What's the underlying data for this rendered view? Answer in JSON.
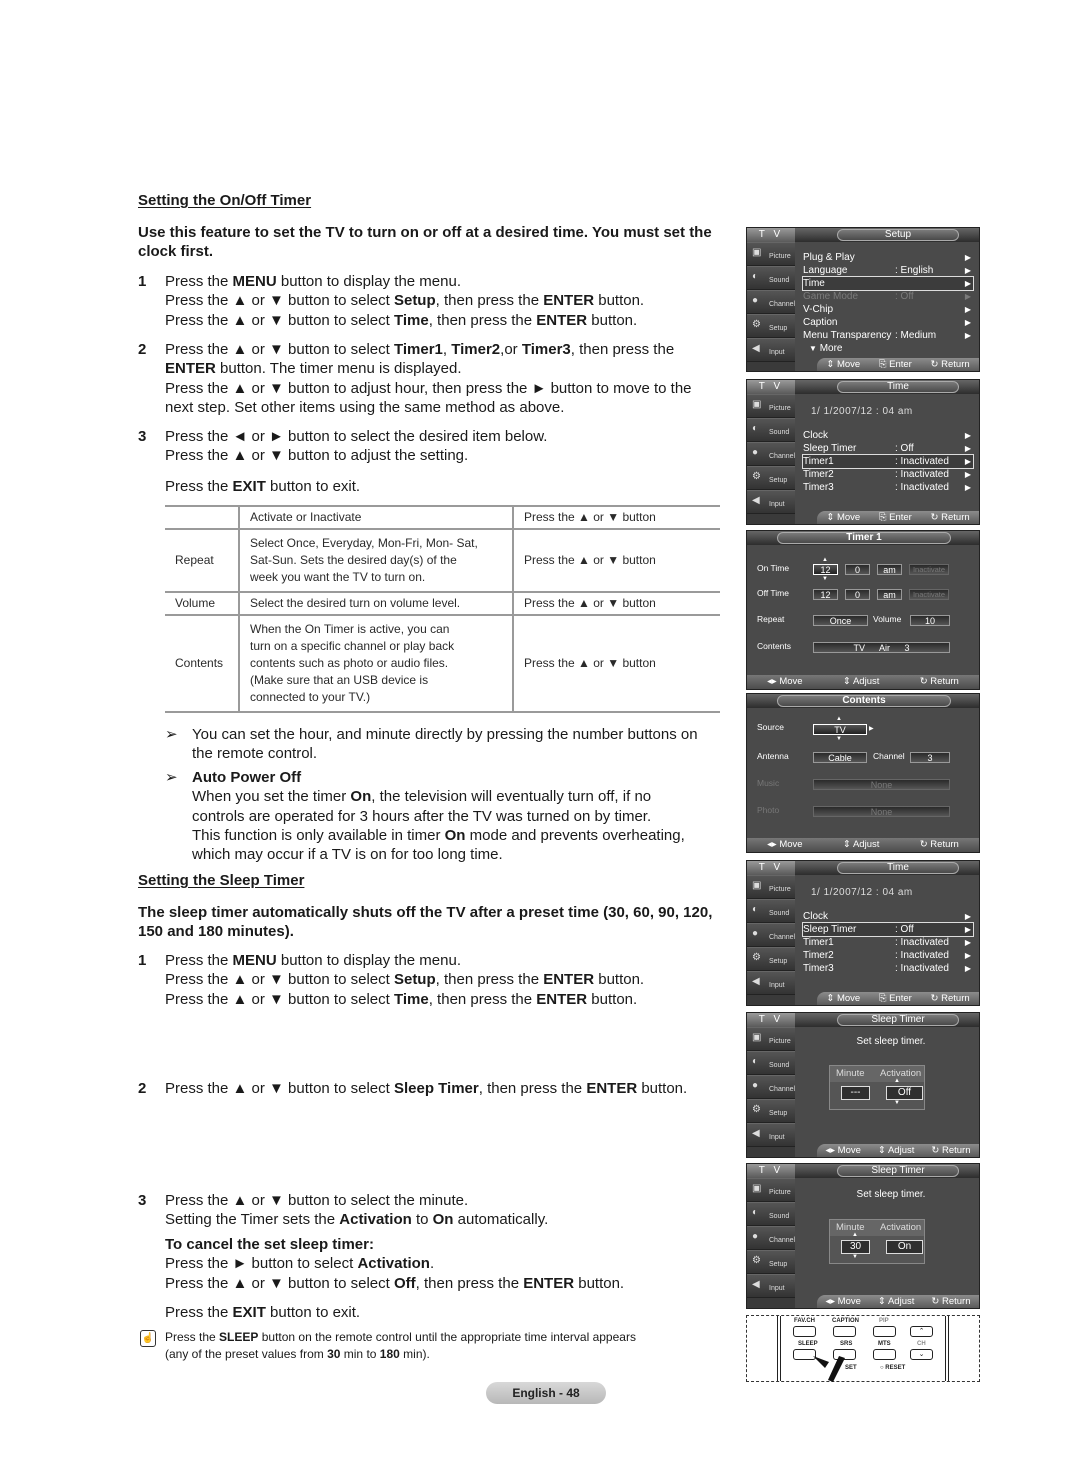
{
  "onoff": {
    "heading": "Setting the On/Off Timer",
    "intro": "Use this feature to set the TV to turn on or off at a desired time. You must set the clock first.",
    "steps": [
      {
        "num": "1",
        "lines": [
          [
            "Press the ",
            {
              "b": "MENU"
            },
            " button to display the menu."
          ],
          [
            "Press the ▲ or ▼ button to select ",
            {
              "b": "Setup"
            },
            ", then press the ",
            {
              "b": "ENTER"
            },
            " button."
          ],
          [
            "Press the ▲ or ▼ button to select ",
            {
              "b": "Time"
            },
            ", then press the ",
            {
              "b": "ENTER"
            },
            " button."
          ]
        ]
      },
      {
        "num": "2",
        "lines": [
          [
            "Press the ▲ or ▼ button to select ",
            {
              "b": "Timer1"
            },
            ", ",
            {
              "b": "Timer2"
            },
            ",or ",
            {
              "b": "Timer3"
            },
            ", then press the"
          ],
          [
            {
              "b": "ENTER"
            },
            " button. The timer menu is displayed."
          ],
          [
            "Press the ▲ or ▼ button to adjust hour, then press the ► button to move to the"
          ],
          [
            "next step. Set other items using the same method as above."
          ]
        ]
      },
      {
        "num": "3",
        "lines": [
          [
            "Press the ◄ or ► button to select the desired item below."
          ],
          [
            "Press the ▲ or ▼ button to adjust the setting."
          ]
        ]
      },
      {
        "num": "",
        "lines": [
          [
            "Press the ",
            {
              "b": "EXIT"
            },
            " button to exit."
          ]
        ]
      }
    ],
    "table": [
      {
        "item": "",
        "desc": [
          "Activate or Inactivate"
        ],
        "action": "Press the ▲ or ▼ button"
      },
      {
        "item": "Repeat",
        "desc": [
          "Select Once, Everyday, Mon-Fri, Mon- Sat,",
          "Sat-Sun. Sets the desired day(s) of the",
          "week you want the TV to turn on."
        ],
        "action": "Press the ▲ or ▼ button"
      },
      {
        "item": "Volume",
        "desc": [
          "Select the desired turn on volume level."
        ],
        "action": "Press the ▲ or ▼ button"
      },
      {
        "item": "Contents",
        "desc": [
          "When the On Timer is active, you can",
          "turn on a specific channel or play back",
          "contents such as photo or audio files.",
          "(Make sure that an USB device is",
          "connected to your TV.)"
        ],
        "action": "Press the ▲ or ▼ button"
      }
    ],
    "note1": {
      "symbol": "➢",
      "lines": [
        [
          "You can set the hour, and minute directly by pressing the number buttons on"
        ],
        [
          "the remote control."
        ]
      ]
    },
    "note2": {
      "symbol": "➢",
      "lines": [
        [
          {
            "b": "Auto Power Off"
          }
        ],
        [
          "When you set the timer ",
          {
            "b": "On"
          },
          ", the television will eventually turn off, if no"
        ],
        [
          "controls are operated for 3 hours after the TV was turned on by timer."
        ],
        [
          "This function is only available in timer ",
          {
            "b": "On"
          },
          " mode and prevents overheating,"
        ],
        [
          "which may occur if a TV is on for too long time."
        ]
      ]
    }
  },
  "sleep": {
    "heading": "Setting the Sleep Timer",
    "intro": "The sleep timer automatically shuts off the TV after a preset time (30, 60, 90, 120, 150 and 180 minutes).",
    "step1": {
      "num": "1",
      "lines": [
        [
          "Press the ",
          {
            "b": "MENU"
          },
          " button to display the menu."
        ],
        [
          "Press the ▲ or ▼ button to select ",
          {
            "b": "Setup"
          },
          ", then press the ",
          {
            "b": "ENTER"
          },
          " button."
        ],
        [
          "Press the ▲ or ▼ button to select ",
          {
            "b": "Time"
          },
          ", then press the ",
          {
            "b": "ENTER"
          },
          " button."
        ]
      ]
    },
    "step2": {
      "num": "2",
      "lines": [
        [
          "Press the ▲ or ▼ button to select ",
          {
            "b": "Sleep Timer"
          },
          ", then press the ",
          {
            "b": "ENTER"
          },
          " button."
        ]
      ]
    },
    "step3": {
      "num": "3",
      "lines": [
        [
          "Press the ▲ or ▼ button to select the minute."
        ],
        [
          "Setting the Timer sets the ",
          {
            "b": "Activation"
          },
          " to ",
          {
            "b": "On"
          },
          " automatically."
        ]
      ]
    },
    "cancel_heading": "To cancel the set sleep timer:",
    "cancel_lines": [
      [
        "Press the ► button to select ",
        {
          "b": "Activation"
        },
        "."
      ],
      [
        "Press the ▲ or ▼ button to select ",
        {
          "b": "Off"
        },
        ", then press the ",
        {
          "b": "ENTER"
        },
        " button."
      ]
    ],
    "exit_line": [
      "Press the ",
      {
        "b": "EXIT"
      },
      " button to exit."
    ],
    "tip": [
      [
        "Press the ",
        {
          "b": "SLEEP"
        },
        " button on the remote control until the appropriate time interval appears"
      ],
      [
        "(any of the preset values from ",
        {
          "b": "30"
        },
        " min to ",
        {
          "b": "180"
        },
        " min)."
      ]
    ],
    "tip_icon": "☝"
  },
  "page_label": "English - 48",
  "osd": {
    "tv_label": "T V",
    "sidebar": [
      {
        "icon": "picture-icon",
        "glyph": "▣",
        "label": "Picture"
      },
      {
        "icon": "sound-icon",
        "glyph": "◐",
        "label": "Sound"
      },
      {
        "icon": "channel-icon",
        "glyph": "●",
        "label": "Channel"
      },
      {
        "icon": "setup-icon",
        "glyph": "⚙",
        "label": "Setup"
      },
      {
        "icon": "input-icon",
        "glyph": "◀",
        "label": "Input"
      }
    ],
    "footer": {
      "move": "Move",
      "enter": "Enter",
      "adjust": "Adjust",
      "return": "Return"
    },
    "setup": {
      "title": "Setup",
      "items": [
        {
          "label": "Plug & Play",
          "value": "",
          "state": ""
        },
        {
          "label": "Language",
          "value": ": English",
          "state": ""
        },
        {
          "label": "Time",
          "value": "",
          "state": "selected"
        },
        {
          "label": "Game Mode",
          "value": ": Off",
          "state": "disabled"
        },
        {
          "label": "V-Chip",
          "value": "",
          "state": ""
        },
        {
          "label": "Caption",
          "value": "",
          "state": ""
        },
        {
          "label": "Menu Transparency",
          "value": ": Medium",
          "state": ""
        }
      ],
      "more": "More"
    },
    "time1": {
      "title": "Time",
      "datetime": "1/ 1/2007/12 : 04 am",
      "items": [
        {
          "label": "Clock",
          "value": "",
          "state": ""
        },
        {
          "label": "Sleep Timer",
          "value": ": Off",
          "state": ""
        },
        {
          "label": "Timer1",
          "value": ": Inactivated",
          "state": "selected"
        },
        {
          "label": "Timer2",
          "value": ": Inactivated",
          "state": ""
        },
        {
          "label": "Timer3",
          "value": ": Inactivated",
          "state": ""
        }
      ]
    },
    "timer1": {
      "title": "Timer 1",
      "on_time": {
        "label": "On Time",
        "hour": "12",
        "minute": "0",
        "ampm": "am",
        "status": "Inactivate"
      },
      "off_time": {
        "label": "Off Time",
        "hour": "12",
        "minute": "0",
        "ampm": "am",
        "status": "Inactivate"
      },
      "repeat": {
        "label": "Repeat",
        "value": "Once"
      },
      "volume": {
        "label": "Volume",
        "value": "10"
      },
      "contents": {
        "label": "Contents",
        "source": "TV",
        "antenna": "Air",
        "channel": "3"
      }
    },
    "contents": {
      "title": "Contents",
      "source": {
        "label": "Source",
        "value": "TV"
      },
      "antenna": {
        "label": "Antenna",
        "value": "Cable"
      },
      "channel": {
        "label": "Channel",
        "value": "3"
      },
      "music": {
        "label": "Music",
        "value": "None"
      },
      "photo": {
        "label": "Photo",
        "value": "None"
      }
    },
    "time2": {
      "title": "Time",
      "datetime": "1/ 1/2007/12 : 04 am",
      "items": [
        {
          "label": "Clock",
          "value": "",
          "state": ""
        },
        {
          "label": "Sleep Timer",
          "value": ": Off",
          "state": "selected"
        },
        {
          "label": "Timer1",
          "value": ": Inactivated",
          "state": ""
        },
        {
          "label": "Timer2",
          "value": ": Inactivated",
          "state": ""
        },
        {
          "label": "Timer3",
          "value": ": Inactivated",
          "state": ""
        }
      ]
    },
    "sleep1": {
      "title": "Sleep Timer",
      "prompt": "Set sleep timer.",
      "minute_label": "Minute",
      "activation_label": "Activation",
      "minute": "---",
      "activation": "Off"
    },
    "sleep2": {
      "title": "Sleep Timer",
      "prompt": "Set sleep timer.",
      "minute_label": "Minute",
      "activation_label": "Activation",
      "minute": "30",
      "activation": "On"
    }
  },
  "remote": {
    "buttons": [
      {
        "label": "FAV.CH",
        "name": "fav-ch-button"
      },
      {
        "label": "CAPTION",
        "name": "caption-button"
      },
      {
        "label": "PIP",
        "name": "pip-button"
      },
      {
        "label": "SLEEP",
        "name": "sleep-button"
      },
      {
        "label": "SRS",
        "name": "srs-button"
      },
      {
        "label": "MTS",
        "name": "mts-button"
      },
      {
        "label": "CH",
        "name": "ch-label"
      }
    ],
    "set_label": "SET",
    "reset_label": "RESET"
  }
}
